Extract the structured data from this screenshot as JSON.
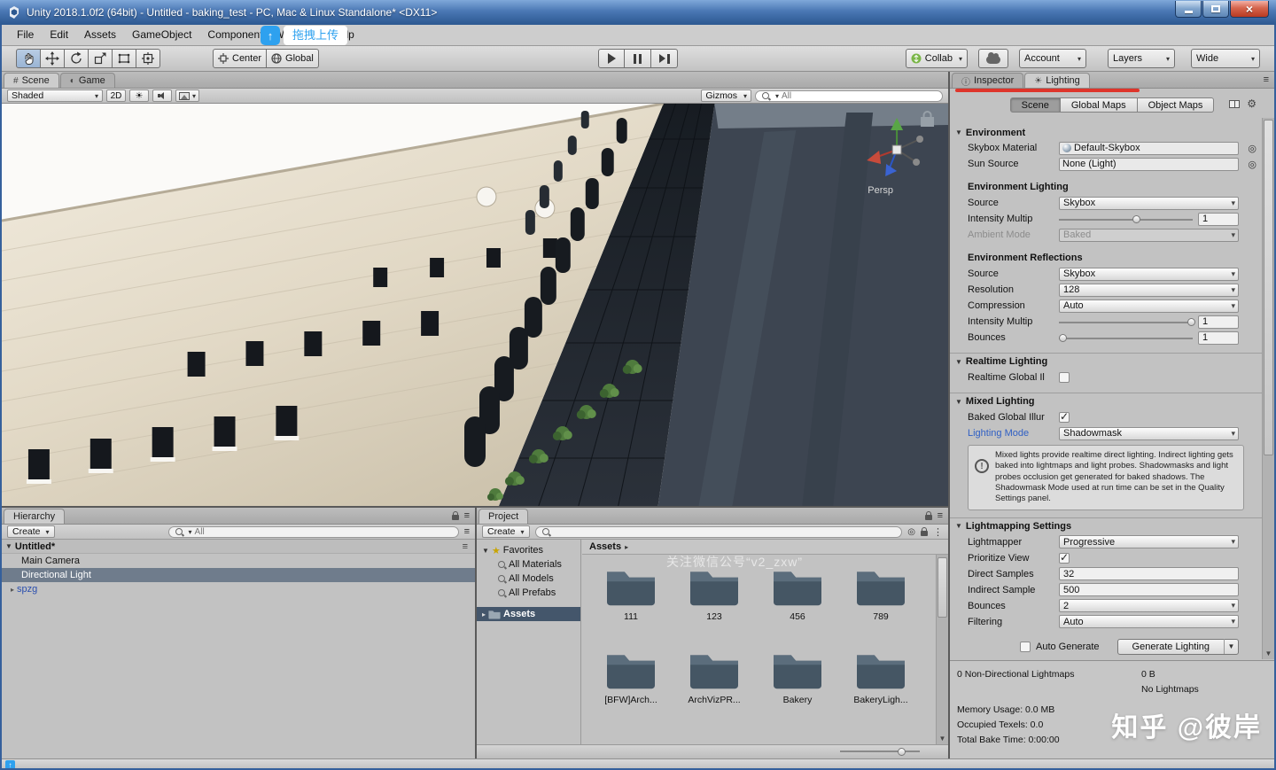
{
  "window": {
    "title": "Unity 2018.1.0f2 (64bit) - Untitled - baking_test - PC, Mac & Linux Standalone* <DX11>"
  },
  "watermarks": {
    "upload": "拖拽上传",
    "wechat": "关注微信公号“v2_zxw”",
    "zhihu": "知乎 @彼岸"
  },
  "menu": {
    "items": [
      "File",
      "Edit",
      "Assets",
      "GameObject",
      "Component",
      "Window",
      "Help"
    ]
  },
  "toolbar": {
    "pivot": "Center",
    "space": "Global",
    "collab": "Collab",
    "account": "Account",
    "layers": "Layers",
    "layout": "Wide"
  },
  "scene_view": {
    "tabs": [
      "Scene",
      "Game"
    ],
    "shading": "Shaded",
    "mode_2d": "2D",
    "gizmos": "Gizmos",
    "search": "All",
    "persp": "Persp"
  },
  "hierarchy": {
    "tab": "Hierarchy",
    "create": "Create",
    "search": "All",
    "scene": "Untitled*",
    "items": [
      {
        "label": "Main Camera"
      },
      {
        "label": "Directional Light"
      },
      {
        "label": "spzg"
      }
    ]
  },
  "project": {
    "tab": "Project",
    "create": "Create",
    "favorites": "Favorites",
    "favorite_items": [
      "All Materials",
      "All Models",
      "All Prefabs"
    ],
    "root": "Assets",
    "breadcrumb": "Assets",
    "folders": [
      "111",
      "123",
      "456",
      "789",
      "[BFW]Arch...",
      "ArchVizPR...",
      "Bakery",
      "BakeryLigh..."
    ]
  },
  "inspector": {
    "tabs": [
      "Inspector",
      "Lighting"
    ]
  },
  "lighting": {
    "tabs": [
      "Scene",
      "Global Maps",
      "Object Maps"
    ],
    "environment": {
      "header": "Environment",
      "skybox_material_label": "Skybox Material",
      "skybox_material_value": "Default-Skybox",
      "sun_source_label": "Sun Source",
      "sun_source_value": "None (Light)",
      "env_lighting_header": "Environment Lighting",
      "source_label": "Source",
      "source_value": "Skybox",
      "intensity_label": "Intensity Multip",
      "intensity_value": "1",
      "ambient_label": "Ambient Mode",
      "ambient_value": "Baked",
      "reflections_header": "Environment Reflections",
      "refl_source_label": "Source",
      "refl_source_value": "Skybox",
      "resolution_label": "Resolution",
      "resolution_value": "128",
      "compression_label": "Compression",
      "compression_value": "Auto",
      "refl_intensity_label": "Intensity Multip",
      "refl_intensity_value": "1",
      "bounces_label": "Bounces",
      "bounces_value": "1"
    },
    "realtime": {
      "header": "Realtime Lighting",
      "gi_label": "Realtime Global Il"
    },
    "mixed": {
      "header": "Mixed Lighting",
      "baked_gi_label": "Baked Global Illur",
      "mode_label": "Lighting Mode",
      "mode_value": "Shadowmask",
      "info": "Mixed lights provide realtime direct lighting. Indirect lighting gets baked into lightmaps and light probes. Shadowmasks and light probes occlusion get generated for baked shadows. The Shadowmask Mode used at run time can be set in the Quality Settings panel."
    },
    "lightmapping": {
      "header": "Lightmapping Settings",
      "lightmapper_label": "Lightmapper",
      "lightmapper_value": "Progressive",
      "prioritize_label": "Prioritize View",
      "direct_label": "Direct Samples",
      "direct_value": "32",
      "indirect_label": "Indirect Sample",
      "indirect_value": "500",
      "bounces_label": "Bounces",
      "bounces_value": "2",
      "filtering_label": "Filtering",
      "filtering_value": "Auto"
    },
    "footer": {
      "auto_generate": "Auto Generate",
      "generate": "Generate Lighting"
    },
    "stats": {
      "lightmaps": "0 Non-Directional Lightmaps",
      "size": "0 B",
      "no_lightmaps": "No Lightmaps",
      "memory": "Memory Usage: 0.0 MB",
      "occupied": "Occupied Texels: 0.0",
      "bake_time": "Total Bake Time: 0:00:00"
    }
  }
}
